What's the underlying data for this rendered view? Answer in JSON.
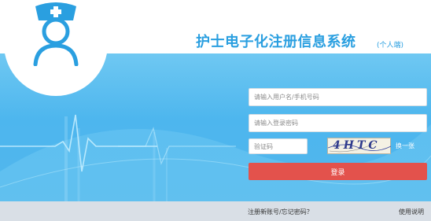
{
  "header": {
    "title": "护士电子化注册信息系统",
    "subtitle": "(个人端)",
    "logo_icon": "nurse-icon"
  },
  "login_form": {
    "username_placeholder": "请输入用户名/手机号码",
    "password_placeholder": "请输入登录密码",
    "captcha_placeholder": "验证码",
    "captcha_image_text": "4HTC",
    "refresh_captcha_label": "换一张",
    "login_button_label": "登录"
  },
  "footer": {
    "register_forgot_link": "注册新账号/忘记密码？",
    "help_link": "使用说明"
  },
  "colors": {
    "brand_blue": "#2a9fe0",
    "banner_blue": "#4db6ee",
    "login_red": "#e3524c",
    "footer_gray": "#d9dfe6"
  }
}
